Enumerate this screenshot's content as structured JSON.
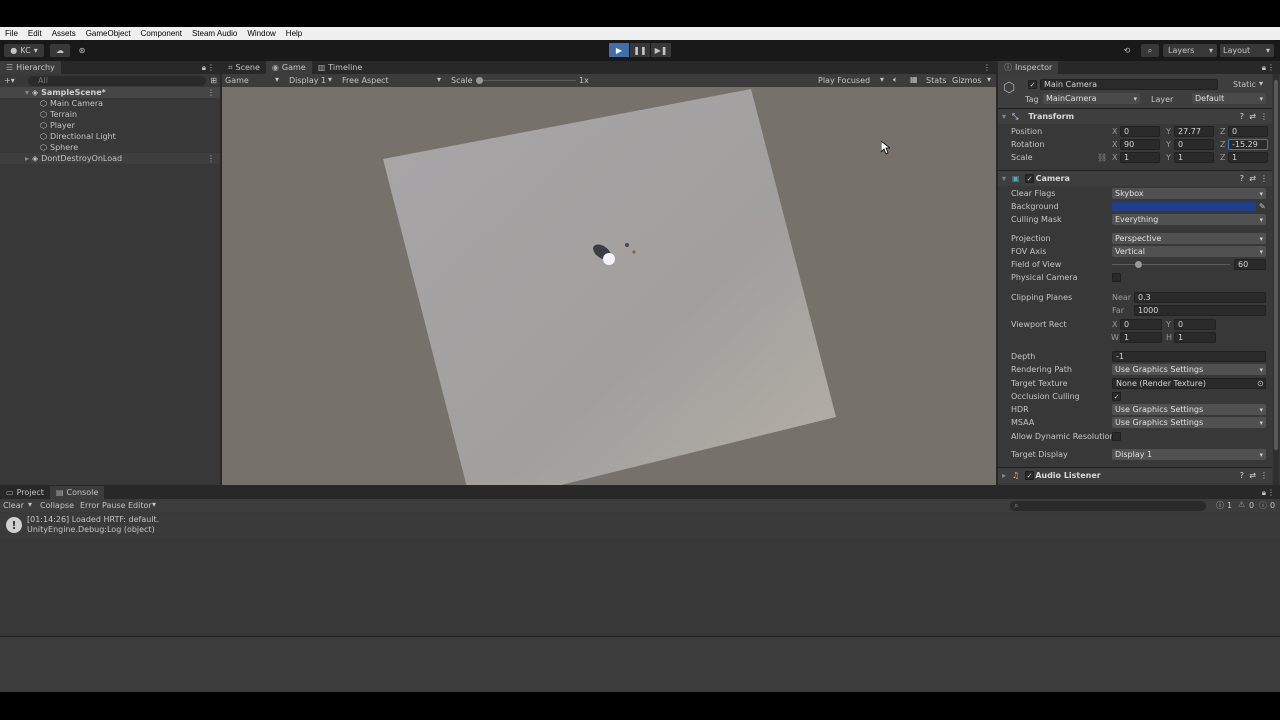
{
  "menu": [
    "File",
    "Edit",
    "Assets",
    "GameObject",
    "Component",
    "Steam Audio",
    "Window",
    "Help"
  ],
  "toolbar": {
    "account": "KC",
    "layers": "Layers",
    "layout": "Layout",
    "play": "▶",
    "pause": "❚❚",
    "step": "▶❚"
  },
  "hierarchy": {
    "tab": "Hierarchy",
    "search_placeholder": "All",
    "scene": "SampleScene*",
    "items": [
      "Main Camera",
      "Terrain",
      "Player",
      "Directional Light",
      "Sphere"
    ],
    "ddol": "DontDestroyOnLoad"
  },
  "center_tabs": [
    "Scene",
    "Game",
    "Timeline"
  ],
  "game_bar": {
    "view": "Game",
    "display": "Display 1",
    "aspect": "Free Aspect",
    "scale_label": "Scale",
    "scale_value": "1x",
    "play_mode": "Play Focused",
    "stats": "Stats",
    "gizmos": "Gizmos"
  },
  "inspector": {
    "tab": "Inspector",
    "object_name": "Main Camera",
    "static": "Static",
    "tag_label": "Tag",
    "tag": "MainCamera",
    "layer_label": "Layer",
    "layer": "Default",
    "transform": {
      "title": "Transform",
      "position_label": "Position",
      "rotation_label": "Rotation",
      "scale_label": "Scale",
      "position": {
        "x": "0",
        "y": "27.77",
        "z": "0"
      },
      "rotation": {
        "x": "90",
        "y": "0",
        "z": "-15.29"
      },
      "scale": {
        "x": "1",
        "y": "1",
        "z": "1"
      }
    },
    "camera": {
      "title": "Camera",
      "clear_flags_label": "Clear Flags",
      "clear_flags": "Skybox",
      "background_label": "Background",
      "background_color": "#1f3f8a",
      "culling_mask_label": "Culling Mask",
      "culling_mask": "Everything",
      "projection_label": "Projection",
      "projection": "Perspective",
      "fov_axis_label": "FOV Axis",
      "fov_axis": "Vertical",
      "fov_label": "Field of View",
      "fov": "60",
      "fov_fraction": 0.22,
      "physical_label": "Physical Camera",
      "clipping_label": "Clipping Planes",
      "near_label": "Near",
      "near": "0.3",
      "far_label": "Far",
      "far": "1000",
      "viewport_label": "Viewport Rect",
      "vp": {
        "x": "0",
        "y": "0",
        "w": "1",
        "h": "1"
      },
      "depth_label": "Depth",
      "depth": "-1",
      "rendering_path_label": "Rendering Path",
      "rendering_path": "Use Graphics Settings",
      "target_texture_label": "Target Texture",
      "target_texture": "None (Render Texture)",
      "occlusion_label": "Occlusion Culling",
      "hdr_label": "HDR",
      "hdr": "Use Graphics Settings",
      "msaa_label": "MSAA",
      "msaa": "Use Graphics Settings",
      "dyn_res_label": "Allow Dynamic Resolution",
      "target_display_label": "Target Display",
      "target_display": "Display 1"
    },
    "audio_listener": "Audio Listener"
  },
  "bottom": {
    "tabs": [
      "Project",
      "Console"
    ],
    "clear": "Clear",
    "collapse": "Collapse",
    "error_pause": "Error Pause",
    "editor": "Editor",
    "counts": {
      "logs": "1",
      "warnings": "0",
      "errors": "0"
    },
    "log_line1": "[01:14:26] Loaded HRTF: default.",
    "log_line2": "UnityEngine.Debug:Log (object)"
  }
}
